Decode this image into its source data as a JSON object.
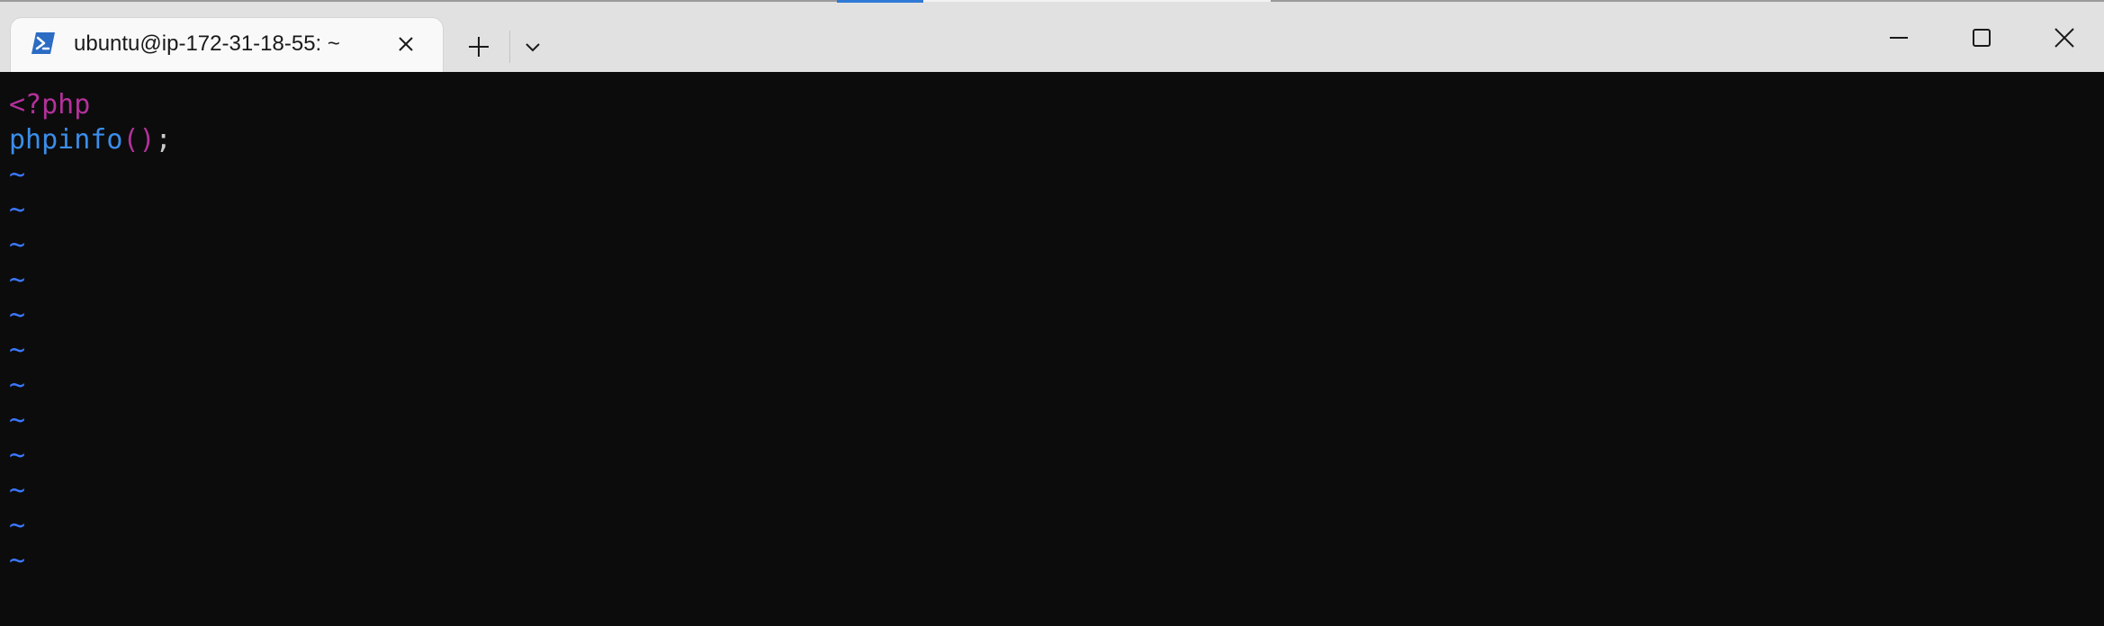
{
  "window": {
    "tab_title": "ubuntu@ip-172-31-18-55: ~",
    "tab_icon": "powershell-icon",
    "buttons": {
      "new_tab_icon": "plus-icon",
      "dropdown_icon": "chevron-down-icon",
      "close_tab_icon": "close-icon",
      "minimize_icon": "minimize-icon",
      "maximize_icon": "maximize-icon",
      "close_window_icon": "close-icon"
    },
    "colors": {
      "titlebar_bg": "#e1e1e1",
      "tab_bg": "#f9f9f9",
      "accent": "#2f7ad6",
      "terminal_bg": "#0c0c0c"
    }
  },
  "editor": {
    "lines": [
      {
        "segments": [
          {
            "text": "<?php",
            "color": "#b4319b"
          }
        ]
      },
      {
        "segments": [
          {
            "text": "phpinfo",
            "color": "#3b8eea"
          },
          {
            "text": "()",
            "color": "#b4319b"
          },
          {
            "text": ";",
            "color": "#cccccc"
          }
        ]
      }
    ],
    "empty_line_marker": "~",
    "empty_line_count": 12,
    "tilde_color": "#3b78ff"
  }
}
